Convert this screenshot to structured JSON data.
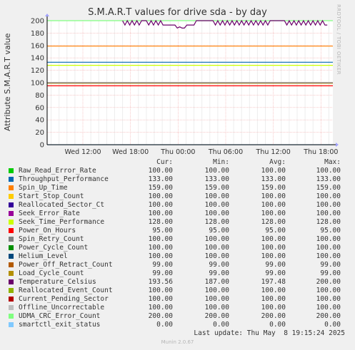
{
  "header": {
    "title": "S.M.A.R.T values for drive sda - by day",
    "side_label": "RRDTOOL / TOBI OETIKER",
    "ylabel": "Attribute S.M.A.R.T value"
  },
  "legend": {
    "columns": [
      "Cur:",
      "Min:",
      "Avg:",
      "Max:"
    ],
    "rows": [
      {
        "name": "Raw_Read_Error_Rate",
        "color": "#00cc00",
        "cur": "100.00",
        "min": "100.00",
        "avg": "100.00",
        "max": "100.00"
      },
      {
        "name": "Throughput_Performance",
        "color": "#0066b3",
        "cur": "133.00",
        "min": "133.00",
        "avg": "133.00",
        "max": "133.00"
      },
      {
        "name": "Spin_Up_Time",
        "color": "#ff8000",
        "cur": "159.00",
        "min": "159.00",
        "avg": "159.00",
        "max": "159.00"
      },
      {
        "name": "Start_Stop_Count",
        "color": "#ffcc00",
        "cur": "100.00",
        "min": "100.00",
        "avg": "100.00",
        "max": "100.00"
      },
      {
        "name": "Reallocated_Sector_Ct",
        "color": "#330099",
        "cur": "100.00",
        "min": "100.00",
        "avg": "100.00",
        "max": "100.00"
      },
      {
        "name": "Seek_Error_Rate",
        "color": "#990099",
        "cur": "100.00",
        "min": "100.00",
        "avg": "100.00",
        "max": "100.00"
      },
      {
        "name": "Seek_Time_Performance",
        "color": "#ccff00",
        "cur": "128.00",
        "min": "128.00",
        "avg": "128.00",
        "max": "128.00"
      },
      {
        "name": "Power_On_Hours",
        "color": "#ff0000",
        "cur": "95.00",
        "min": "95.00",
        "avg": "95.00",
        "max": "95.00"
      },
      {
        "name": "Spin_Retry_Count",
        "color": "#808080",
        "cur": "100.00",
        "min": "100.00",
        "avg": "100.00",
        "max": "100.00"
      },
      {
        "name": "Power_Cycle_Count",
        "color": "#008f00",
        "cur": "100.00",
        "min": "100.00",
        "avg": "100.00",
        "max": "100.00"
      },
      {
        "name": "Helium_Level",
        "color": "#00487d",
        "cur": "100.00",
        "min": "100.00",
        "avg": "100.00",
        "max": "100.00"
      },
      {
        "name": "Power_Off_Retract_Count",
        "color": "#b35a00",
        "cur": "99.00",
        "min": "99.00",
        "avg": "99.00",
        "max": "99.00"
      },
      {
        "name": "Load_Cycle_Count",
        "color": "#b38f00",
        "cur": "99.00",
        "min": "99.00",
        "avg": "99.00",
        "max": "99.00"
      },
      {
        "name": "Temperature_Celsius",
        "color": "#6b006b",
        "cur": "193.56",
        "min": "187.00",
        "avg": "197.48",
        "max": "200.00"
      },
      {
        "name": "Reallocated_Event_Count",
        "color": "#8fb300",
        "cur": "100.00",
        "min": "100.00",
        "avg": "100.00",
        "max": "100.00"
      },
      {
        "name": "Current_Pending_Sector",
        "color": "#b30000",
        "cur": "100.00",
        "min": "100.00",
        "avg": "100.00",
        "max": "100.00"
      },
      {
        "name": "Offline_Uncorrectable",
        "color": "#bebebe",
        "cur": "100.00",
        "min": "100.00",
        "avg": "100.00",
        "max": "100.00"
      },
      {
        "name": "UDMA_CRC_Error_Count",
        "color": "#80ff80",
        "cur": "200.00",
        "min": "200.00",
        "avg": "200.00",
        "max": "200.00"
      },
      {
        "name": "smartctl_exit_status",
        "color": "#80c9ff",
        "cur": "0.00",
        "min": "0.00",
        "avg": "0.00",
        "max": "0.00"
      }
    ]
  },
  "footer": {
    "last_update": "Last update: Thu May  8 19:15:24 2025",
    "munin": "Munin 2.0.67"
  },
  "chart_data": {
    "type": "line",
    "title": "S.M.A.R.T values for drive sda - by day",
    "ylabel": "Attribute S.M.A.R.T value",
    "ylim": [
      0,
      200
    ],
    "yticks": [
      0,
      20,
      40,
      60,
      80,
      100,
      120,
      140,
      160,
      180,
      200
    ],
    "xticks": [
      "Wed 12:00",
      "Wed 18:00",
      "Thu 00:00",
      "Thu 06:00",
      "Thu 12:00",
      "Thu 18:00"
    ],
    "grid": true,
    "flat_series": [
      {
        "name": "Raw_Read_Error_Rate",
        "value": 100
      },
      {
        "name": "Throughput_Performance",
        "value": 133
      },
      {
        "name": "Spin_Up_Time",
        "value": 159
      },
      {
        "name": "Start_Stop_Count",
        "value": 100
      },
      {
        "name": "Reallocated_Sector_Ct",
        "value": 100
      },
      {
        "name": "Seek_Error_Rate",
        "value": 100
      },
      {
        "name": "Seek_Time_Performance",
        "value": 128
      },
      {
        "name": "Power_On_Hours",
        "value": 95
      },
      {
        "name": "Spin_Retry_Count",
        "value": 100
      },
      {
        "name": "Power_Cycle_Count",
        "value": 100
      },
      {
        "name": "Helium_Level",
        "value": 100
      },
      {
        "name": "Power_Off_Retract_Count",
        "value": 99
      },
      {
        "name": "Load_Cycle_Count",
        "value": 99
      },
      {
        "name": "Reallocated_Event_Count",
        "value": 100
      },
      {
        "name": "Current_Pending_Sector",
        "value": 100
      },
      {
        "name": "Offline_Uncorrectable",
        "value": 100
      },
      {
        "name": "UDMA_CRC_Error_Count",
        "value": 200
      },
      {
        "name": "smartctl_exit_status",
        "value": 0
      }
    ],
    "temperature_series": {
      "name": "Temperature_Celsius",
      "x_hours": [
        17.0,
        17.3,
        17.6,
        17.9,
        18.2,
        18.5,
        18.8,
        19.1,
        19.4,
        19.7,
        20.0,
        20.3,
        20.6,
        20.9,
        21.2,
        21.5,
        21.8,
        22.1,
        22.4,
        22.7,
        23.0,
        23.3,
        23.6,
        23.9,
        24.2,
        24.5,
        24.8,
        25.1,
        25.4,
        25.7,
        26.0,
        26.3,
        26.6,
        26.9,
        27.2,
        27.5,
        27.8,
        28.1,
        28.4,
        28.7,
        29.0,
        29.3,
        29.6,
        29.9,
        30.2,
        30.5,
        30.8,
        31.1,
        31.4,
        31.7,
        32.0,
        32.3,
        32.6,
        32.9,
        33.2,
        33.5,
        33.8,
        34.1,
        34.4,
        34.7,
        35.0,
        35.3,
        35.6,
        35.9,
        36.2,
        36.5,
        36.8,
        37.1,
        37.4,
        37.7,
        38.0,
        38.3,
        38.6,
        38.9,
        39.2,
        39.5,
        39.8,
        40.1,
        40.4,
        40.7,
        41.0,
        41.3,
        41.6,
        41.9,
        42.2,
        42.5,
        42.8
      ],
      "values": [
        200,
        193,
        200,
        193,
        200,
        193,
        200,
        193,
        200,
        200,
        200,
        193,
        200,
        193,
        200,
        193,
        200,
        193,
        193,
        193,
        193,
        193,
        193,
        188,
        190,
        188,
        188,
        193,
        193,
        193,
        193,
        200,
        200,
        200,
        200,
        200,
        200,
        200,
        200,
        193,
        200,
        193,
        200,
        193,
        200,
        193,
        200,
        193,
        200,
        193,
        200,
        193,
        200,
        193,
        200,
        193,
        200,
        193,
        200,
        193,
        200,
        193,
        200,
        200,
        200,
        200,
        200,
        200,
        200,
        193,
        200,
        193,
        200,
        193,
        200,
        193,
        200,
        193,
        200,
        193,
        200,
        193,
        200,
        193,
        200,
        193,
        193
      ]
    },
    "x_range_hours": [
      7.5,
      43.5
    ],
    "x_tick_hours": [
      12,
      18,
      24,
      30,
      36,
      42
    ]
  }
}
